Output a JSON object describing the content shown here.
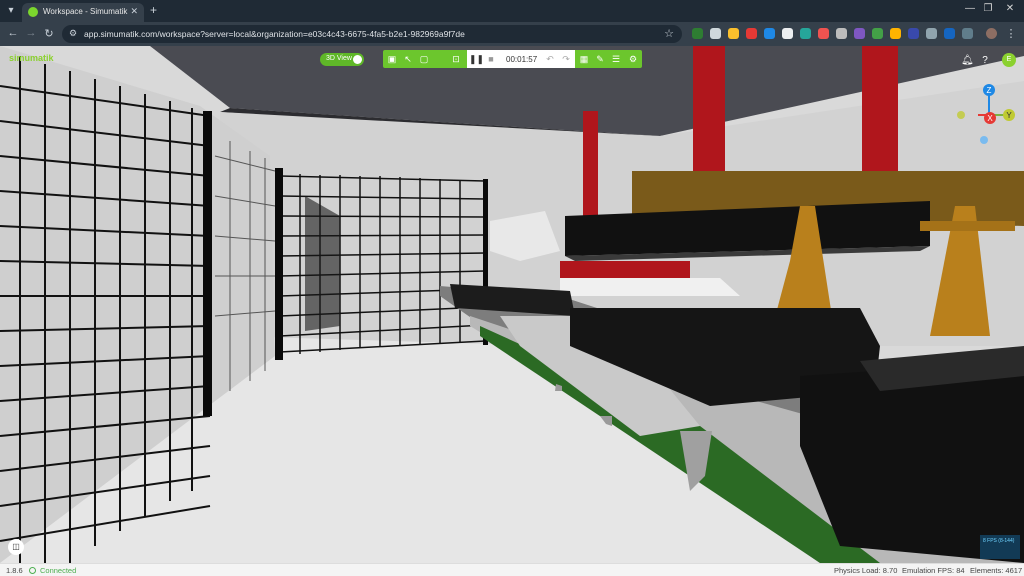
{
  "browser": {
    "tab_title": "Workspace - Simumatik",
    "url": "app.simumatik.com/workspace?server=local&organization=e03c4c43-6675-4fa5-b2e1-982969a9f7de",
    "tab_menu_icon": "chevron-down-icon",
    "new_tab_icon": "plus-icon",
    "window_controls": [
      "minimize-icon",
      "maximize-icon",
      "close-icon"
    ]
  },
  "app": {
    "logo": "simumatik",
    "view_mode_label": "3D View",
    "toolbar": {
      "timer": "00:01:57",
      "buttons_left": [
        "panel-icon",
        "cursor-icon",
        "frame-icon",
        "snap-icon"
      ],
      "playback": [
        "pause-icon",
        "stop-icon"
      ],
      "history": [
        "undo-icon",
        "redo-icon"
      ],
      "buttons_right": [
        "grid-icon",
        "pen-icon",
        "list-icon",
        "settings-icon"
      ]
    },
    "top_right_icons": [
      "notification-icon",
      "help-icon"
    ],
    "avatar_initial": "E",
    "gizmo": {
      "z": "Z",
      "x": "X",
      "y": "Y"
    },
    "fps_overlay": "8 FPS (8-144)"
  },
  "status": {
    "version": "1.8.6",
    "connection": "Connected",
    "physics_load": "Physics Load: 8.70",
    "emulation_fps": "Emulation FPS: 84",
    "elements": "Elements: 4617"
  },
  "colors": {
    "brand_green": "#6cc62d",
    "chrome_dark": "#1f2a35",
    "chrome_mid": "#35404b",
    "status_connected": "#4caf50"
  }
}
